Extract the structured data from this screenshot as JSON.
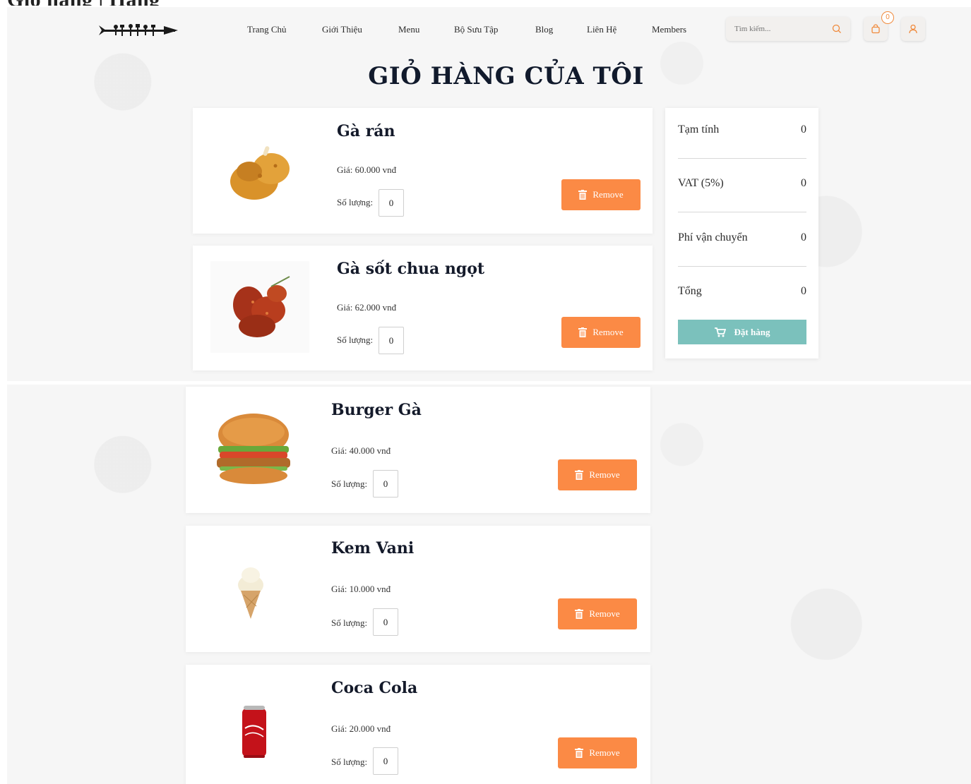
{
  "header": {
    "top_cut_text": "Giỏ hàng | Hàng",
    "nav": [
      "Trang Chủ",
      "Giới Thiệu",
      "Menu",
      "Bộ Sưu Tập",
      "Blog",
      "Liên Hệ",
      "Members"
    ],
    "search_placeholder": "Tìm kiếm...",
    "cart_count": "0",
    "icons": {
      "logo": "utensils-logo",
      "search": "search-icon",
      "cart": "shopping-bag-icon",
      "user": "user-icon"
    }
  },
  "page_title": "GIỎ HÀNG CỦA TÔI",
  "items": [
    {
      "name": "Gà rán",
      "price": "Giá: 60.000 vnđ",
      "qty_label": "Số lượng:",
      "qty": "0",
      "remove": "Remove"
    },
    {
      "name": "Gà sốt chua ngọt",
      "price": "Giá: 62.000 vnđ",
      "qty_label": "Số lượng:",
      "qty": "0",
      "remove": "Remove"
    },
    {
      "name": "Burger Gà",
      "price": "Giá: 40.000 vnđ",
      "qty_label": "Số lượng:",
      "qty": "0",
      "remove": "Remove"
    },
    {
      "name": "Kem Vani",
      "price": "Giá: 10.000 vnđ",
      "qty_label": "Số lượng:",
      "qty": "0",
      "remove": "Remove"
    },
    {
      "name": "Coca Cola",
      "price": "Giá: 20.000 vnđ",
      "qty_label": "Số lượng:",
      "qty": "0",
      "remove": "Remove"
    }
  ],
  "summary": {
    "subtotal_label": "Tạm tính",
    "subtotal": "0",
    "vat_label": "VAT (5%)",
    "vat": "0",
    "shipping_label": "Phí vận chuyển",
    "shipping": "0",
    "total_label": "Tổng",
    "total": "0",
    "order_button": "Đặt hàng"
  },
  "colors": {
    "remove": "#fb8a45",
    "order": "#7bc1bc",
    "accent": "#f08a3c"
  }
}
